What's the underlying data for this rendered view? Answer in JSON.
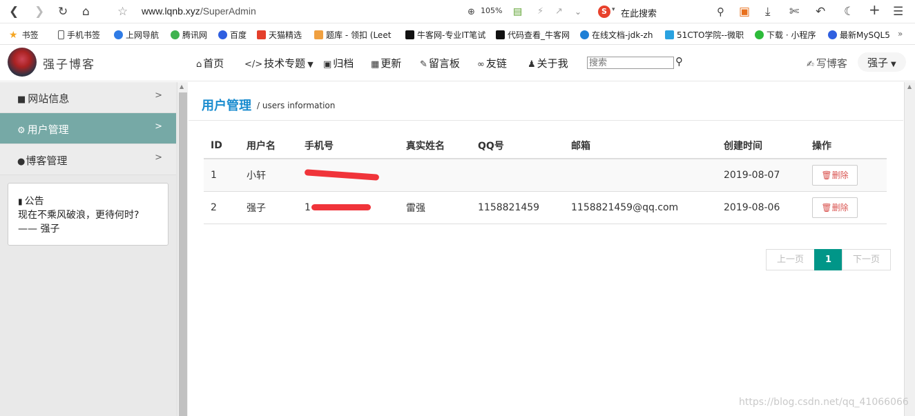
{
  "browser": {
    "url_domain": "www.lqnb.xyz",
    "url_path": "/SuperAdmin",
    "zoom": "105%",
    "search_placeholder": "在此搜索",
    "search_engine_logo": "S"
  },
  "bookmarks": [
    {
      "label": "书签",
      "icon": "star-icon",
      "color": "#f5a623"
    },
    {
      "label": "手机书签",
      "icon": "phone-icon",
      "color": "#555555"
    },
    {
      "label": "上网导航",
      "icon": "nav-icon",
      "color": "#2f7be5"
    },
    {
      "label": "腾讯网",
      "icon": "tencent-icon",
      "color": "#3fb34f"
    },
    {
      "label": "百度",
      "icon": "baidu-icon",
      "color": "#2f5fe0"
    },
    {
      "label": "天猫精选",
      "icon": "tmall-icon",
      "color": "#e43f2b"
    },
    {
      "label": "题库 - 领扣 (Leet",
      "icon": "leetcode-icon",
      "color": "#333333"
    },
    {
      "label": "牛客网-专业IT笔试",
      "icon": "nowcoder-icon",
      "color": "#111111"
    },
    {
      "label": "代码查看_牛客网",
      "icon": "nowcoder-icon",
      "color": "#111111"
    },
    {
      "label": "在线文档-jdk-zh",
      "icon": "doc-icon",
      "color": "#1e7fd6"
    },
    {
      "label": "51CTO学院--微职",
      "icon": "cto-icon",
      "color": "#2aa2e0"
    },
    {
      "label": "下载 · 小程序",
      "icon": "wechat-icon",
      "color": "#2dbb3a"
    },
    {
      "label": "最新MySQL5",
      "icon": "baidu-icon",
      "color": "#2f5fe0"
    }
  ],
  "site": {
    "title": "强子博客",
    "nav": [
      {
        "label": "首页",
        "icon": "home-icon"
      },
      {
        "label": "技术专题",
        "icon": "code-icon"
      },
      {
        "label": "归档",
        "icon": "archive-icon"
      },
      {
        "label": "更新",
        "icon": "calendar-icon"
      },
      {
        "label": "留言板",
        "icon": "pencil-icon"
      },
      {
        "label": "友链",
        "icon": "link-icon"
      },
      {
        "label": "关于我",
        "icon": "user-icon"
      }
    ],
    "search_placeholder": "搜索",
    "write_blog": "写博客",
    "user_name": "强子"
  },
  "sidebar": {
    "items": [
      {
        "label": "网站信息",
        "icon": "file-icon",
        "active": false
      },
      {
        "label": "用户管理",
        "icon": "gear-icon",
        "active": true
      },
      {
        "label": "博客管理",
        "icon": "comment-icon",
        "active": false
      }
    ],
    "notice_title": "公告",
    "notice_line1": "现在不乘风破浪，更待何时?",
    "notice_line2": "—— 强子"
  },
  "main": {
    "title": "用户管理",
    "subtitle": "/ users information",
    "columns": [
      "ID",
      "用户名",
      "手机号",
      "真实姓名",
      "QQ号",
      "邮箱",
      "创建时间",
      "操作"
    ],
    "rows": [
      {
        "id": "1",
        "username": "小轩",
        "phone": "",
        "realname": "",
        "qq": "",
        "email": "",
        "created": "2019-08-07",
        "action": "删除"
      },
      {
        "id": "2",
        "username": "强子",
        "phone": "1",
        "realname": "雷强",
        "qq": "1158821459",
        "email": "1158821459@qq.com",
        "created": "2019-08-06",
        "action": "删除"
      }
    ],
    "pager": {
      "prev": "上一页",
      "current": "1",
      "next": "下一页"
    }
  },
  "watermark": "https://blog.csdn.net/qq_41066066"
}
